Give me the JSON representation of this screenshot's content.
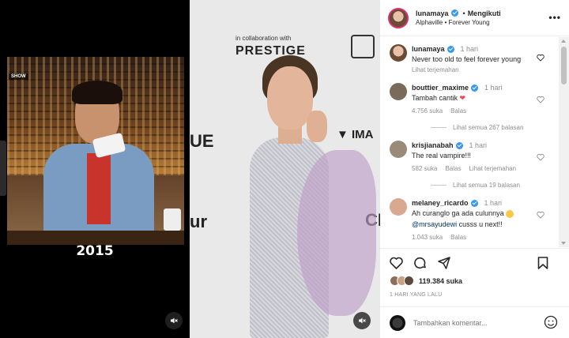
{
  "media": {
    "left_clip": {
      "badge": "SHOW",
      "year": "2015"
    },
    "right_clip": {
      "backdrop_collab": "in collaboration with",
      "backdrop_brand": "PRESTIGE",
      "backdrop_vima": "IMA",
      "backdrop_ue": "UE",
      "backdrop_ur": "ur",
      "backdrop_cl": "CL"
    }
  },
  "header": {
    "username": "lunamaya",
    "follow_status": "Mengikuti",
    "subtitle": "Alphaville • Forever Young",
    "more_icon": "ellipsis-icon"
  },
  "comments": [
    {
      "user": "lunamaya",
      "verified": true,
      "time": "1 hari",
      "text": "Never too old to feel forever young",
      "meta": [
        "Lihat terjemahan"
      ],
      "avatar_color": "#e8c2a8"
    },
    {
      "user": "bouttier_maxime",
      "verified": true,
      "time": "1 hari",
      "text": "Tambah cantik",
      "meta": [
        "4.756 suka",
        "Balas"
      ],
      "replies": "Lihat semua 267 balasan",
      "avatar_color": "#7a6a5a"
    },
    {
      "user": "krisjianabah",
      "verified": true,
      "time": "1 hari",
      "text": "The real vampire!!!",
      "meta": [
        "582 suka",
        "Balas",
        "Lihat terjemahan"
      ],
      "replies": "Lihat semua 19 balasan",
      "avatar_color": "#9a8a7a"
    },
    {
      "user": "melaney_ricardo",
      "verified": true,
      "time": "1 hari",
      "text": "Ah curanglo ga ada culunnya",
      "mention": "@mrsayudewi",
      "text_after": " cusss u next!!",
      "meta": [
        "1.043 suka",
        "Balas"
      ],
      "avatar_color": "#d8a890"
    }
  ],
  "actions": {
    "likes": "119.384 suka",
    "posted": "1 HARI YANG LALU",
    "add_placeholder": "Tambahkan komentar..."
  },
  "colors": {
    "verified": "#3897f0",
    "muted": "#8e8e8e",
    "story_ring": "#d8326e",
    "heart_red": "#ed4956"
  }
}
